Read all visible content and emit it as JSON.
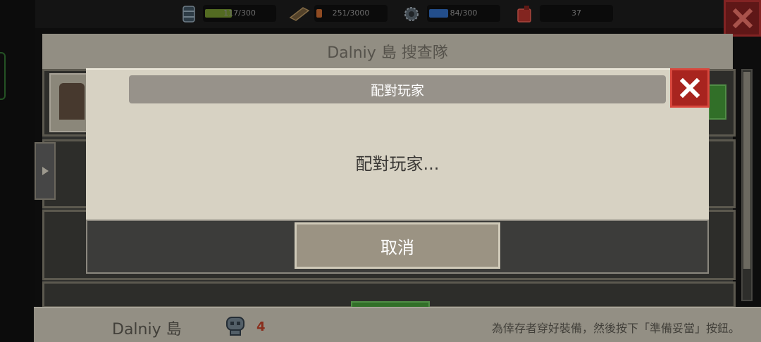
{
  "resources": [
    {
      "icon": "water-barrel-icon",
      "text": "117/300",
      "level": 0.39,
      "color": "#6b8a2c"
    },
    {
      "icon": "wood-plank-icon",
      "text": "251/3000",
      "level": 0.08,
      "color": "#b8612c"
    },
    {
      "icon": "gear-icon",
      "text": "84/300",
      "level": 0.28,
      "color": "#2d64b3"
    },
    {
      "icon": "fuel-can-icon",
      "text": "37",
      "level": 0,
      "color": "#b2392f"
    }
  ],
  "header": {
    "title": "Dalniy 島 搜查隊"
  },
  "dialog": {
    "title": "配對玩家",
    "message": "配對玩家...",
    "cancel_label": "取消"
  },
  "footer": {
    "island_name": "Dalniy 島",
    "survivor_count": "4",
    "hint": "為倖存者穿好裝備，然後按下「準備妥當」按鈕。"
  },
  "colors": {
    "close_red": "#a8241f",
    "panel_beige": "#d7d2c3",
    "button_beige": "#9b9383"
  }
}
